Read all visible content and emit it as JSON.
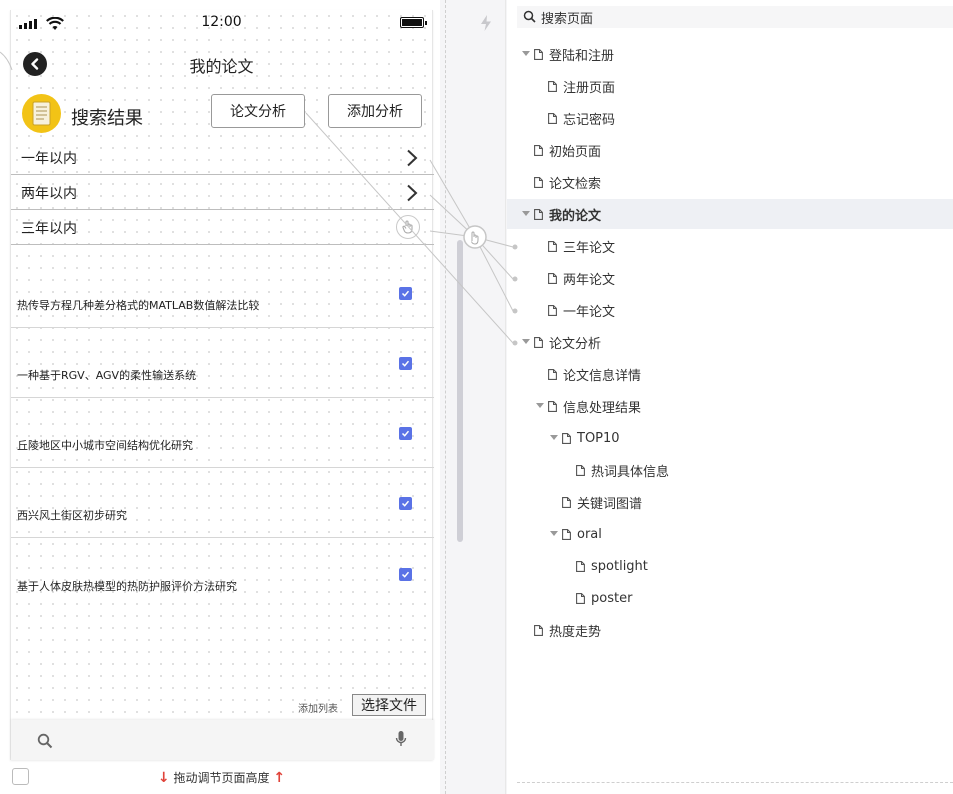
{
  "status": {
    "time": "12:00"
  },
  "header": {
    "title": "我的论文"
  },
  "results": {
    "title": "搜索结果"
  },
  "buttons": {
    "analysis": "论文分析",
    "add_analysis": "添加分析"
  },
  "ranges": [
    {
      "label": "一年以内"
    },
    {
      "label": "两年以内"
    },
    {
      "label": "三年以内"
    }
  ],
  "papers": [
    {
      "title": "热传导方程几种差分格式的MATLAB数值解法比较",
      "checked": true
    },
    {
      "title": "一种基于RGV、AGV的柔性输送系统",
      "checked": true
    },
    {
      "title": "丘陵地区中小城市空间结构优化研究",
      "checked": true
    },
    {
      "title": "西兴风土街区初步研究",
      "checked": true
    },
    {
      "title": "基于人体皮肤热模型的热防护服评价方法研究",
      "checked": true
    }
  ],
  "footer": {
    "add_list": "添加列表",
    "choose_file": "选择文件"
  },
  "resize": {
    "label": "拖动调节页面高度"
  },
  "panel": {
    "search_placeholder": "搜索页面",
    "tree": [
      {
        "label": "登陆和注册",
        "level": 0,
        "expanded": true
      },
      {
        "label": "注册页面",
        "level": 1
      },
      {
        "label": "忘记密码",
        "level": 1
      },
      {
        "label": "初始页面",
        "level": 0
      },
      {
        "label": "论文检索",
        "level": 0
      },
      {
        "label": "我的论文",
        "level": 0,
        "expanded": true,
        "selected": true
      },
      {
        "label": "三年论文",
        "level": 1
      },
      {
        "label": "两年论文",
        "level": 1
      },
      {
        "label": "一年论文",
        "level": 1
      },
      {
        "label": "论文分析",
        "level": 0,
        "expanded": true
      },
      {
        "label": "论文信息详情",
        "level": 1
      },
      {
        "label": "信息处理结果",
        "level": 1,
        "expanded": true
      },
      {
        "label": "TOP10",
        "level": 2,
        "expanded": true
      },
      {
        "label": "热词具体信息",
        "level": 3
      },
      {
        "label": "关键词图谱",
        "level": 2
      },
      {
        "label": "oral",
        "level": 2,
        "expanded": true
      },
      {
        "label": "spotlight",
        "level": 3
      },
      {
        "label": "poster",
        "level": 3
      },
      {
        "label": "热度走势",
        "level": 0
      }
    ]
  },
  "colors": {
    "checkbox": "#5a72e6",
    "icon_yellow": "#f2c316",
    "arrow_red": "#e0433a"
  }
}
